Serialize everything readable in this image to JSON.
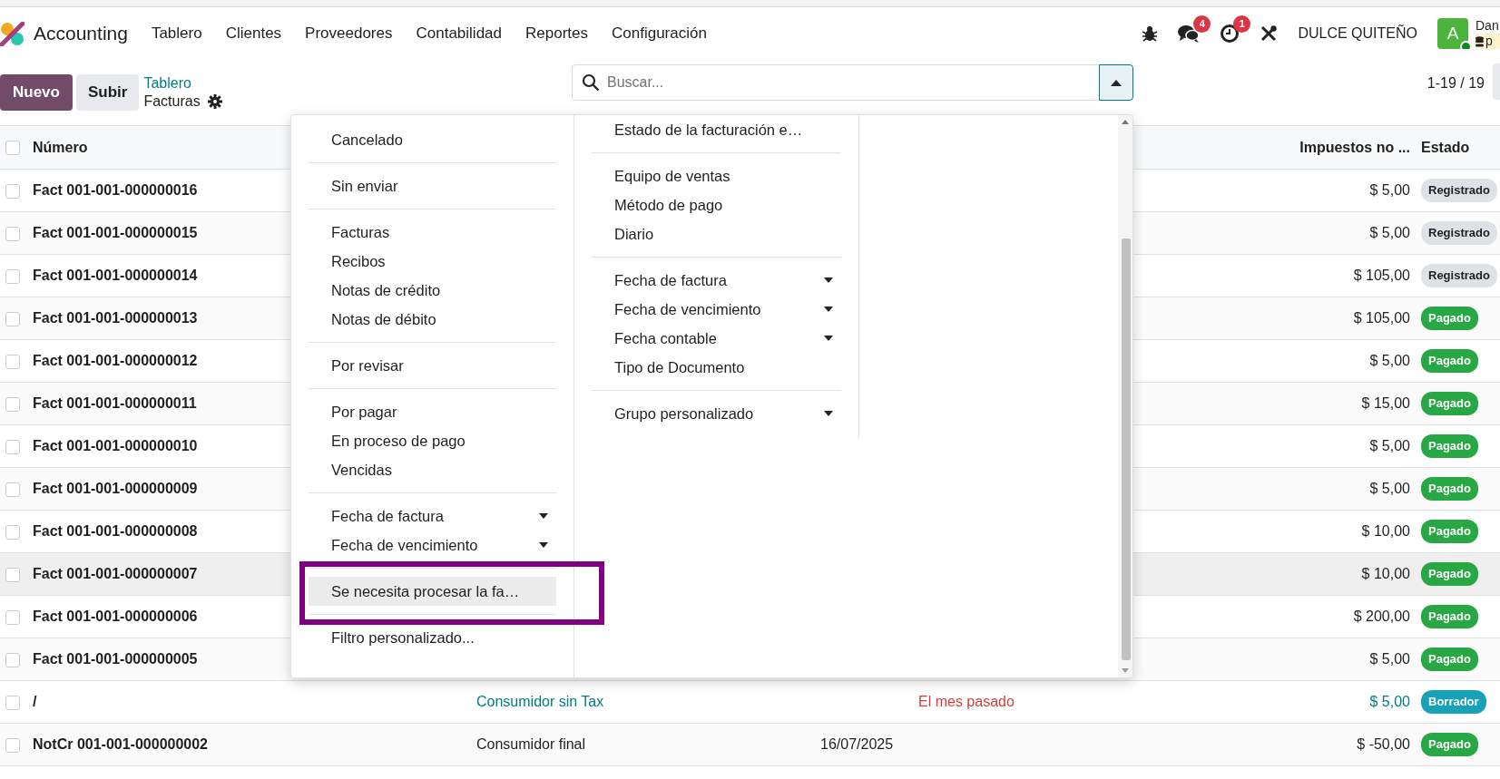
{
  "app": {
    "name": "Accounting"
  },
  "menu": [
    "Tablero",
    "Clientes",
    "Proveedores",
    "Contabilidad",
    "Reportes",
    "Configuración"
  ],
  "systray": {
    "chat_count": "4",
    "activity_count": "1",
    "company": "DULCE QUITEÑO",
    "avatar_letter": "A",
    "online": true,
    "user_name": "Dan",
    "database": "p"
  },
  "control_panel": {
    "new_button": "Nuevo",
    "upload_button": "Subir",
    "breadcrumb": "Tablero",
    "title": "Facturas",
    "search_placeholder": "Buscar...",
    "pager": "1-19 / 19"
  },
  "filter_menu": {
    "filters": [
      [
        {
          "label": "Cancelado",
          "expandable": false,
          "highlighted": false
        }
      ],
      [
        {
          "label": "Sin enviar",
          "expandable": false,
          "highlighted": false
        }
      ],
      [
        {
          "label": "Facturas",
          "expandable": false,
          "highlighted": false
        },
        {
          "label": "Recibos",
          "expandable": false,
          "highlighted": false
        },
        {
          "label": "Notas de crédito",
          "expandable": false,
          "highlighted": false
        },
        {
          "label": "Notas de débito",
          "expandable": false,
          "highlighted": false
        }
      ],
      [
        {
          "label": "Por revisar",
          "expandable": false,
          "highlighted": false
        }
      ],
      [
        {
          "label": "Por pagar",
          "expandable": false,
          "highlighted": false
        },
        {
          "label": "En proceso de pago",
          "expandable": false,
          "highlighted": false
        },
        {
          "label": "Vencidas",
          "expandable": false,
          "highlighted": false
        }
      ],
      [
        {
          "label": "Fecha de factura",
          "expandable": true,
          "highlighted": false
        },
        {
          "label": "Fecha de vencimiento",
          "expandable": true,
          "highlighted": false
        }
      ],
      [
        {
          "label": "Se necesita procesar la fa…",
          "expandable": false,
          "highlighted": true
        }
      ],
      [
        {
          "label": "Filtro personalizado...",
          "expandable": false,
          "highlighted": false
        }
      ]
    ],
    "group_by": [
      [
        {
          "label": "Estado de la facturación e…",
          "expandable": false,
          "highlighted": false
        }
      ],
      [
        {
          "label": "Equipo de ventas",
          "expandable": false,
          "highlighted": false
        },
        {
          "label": "Método de pago",
          "expandable": false,
          "highlighted": false
        },
        {
          "label": "Diario",
          "expandable": false,
          "highlighted": false
        }
      ],
      [
        {
          "label": "Fecha de factura",
          "expandable": true,
          "highlighted": false
        },
        {
          "label": "Fecha de vencimiento",
          "expandable": true,
          "highlighted": false
        },
        {
          "label": "Fecha contable",
          "expandable": true,
          "highlighted": false
        },
        {
          "label": "Tipo de Documento",
          "expandable": false,
          "highlighted": false
        }
      ],
      [
        {
          "label": "Grupo personalizado",
          "expandable": true,
          "highlighted": false
        }
      ]
    ]
  },
  "table": {
    "select_all_checked": false,
    "columns": {
      "number": "Número",
      "amount": "Impuestos no ...",
      "status": "Estado"
    },
    "rows": [
      {
        "number": "Fact 001-001-000000016",
        "amount": "$ 5,00",
        "status": "Registrado",
        "kind": "posted",
        "checked": false,
        "highlighted": false
      },
      {
        "number": "Fact 001-001-000000015",
        "amount": "$ 5,00",
        "status": "Registrado",
        "kind": "posted",
        "checked": false,
        "highlighted": false
      },
      {
        "number": "Fact 001-001-000000014",
        "amount": "$ 105,00",
        "status": "Registrado",
        "kind": "posted",
        "checked": false,
        "highlighted": false
      },
      {
        "number": "Fact 001-001-000000013",
        "amount": "$ 105,00",
        "status": "Pagado",
        "kind": "paid",
        "checked": false,
        "highlighted": false
      },
      {
        "number": "Fact 001-001-000000012",
        "amount": "$ 5,00",
        "status": "Pagado",
        "kind": "paid",
        "checked": false,
        "highlighted": false
      },
      {
        "number": "Fact 001-001-000000011",
        "amount": "$ 15,00",
        "status": "Pagado",
        "kind": "paid",
        "checked": false,
        "highlighted": false
      },
      {
        "number": "Fact 001-001-000000010",
        "amount": "$ 5,00",
        "status": "Pagado",
        "kind": "paid",
        "checked": false,
        "highlighted": false
      },
      {
        "number": "Fact 001-001-000000009",
        "amount": "$ 5,00",
        "status": "Pagado",
        "kind": "paid",
        "checked": false,
        "highlighted": false
      },
      {
        "number": "Fact 001-001-000000008",
        "amount": "$ 10,00",
        "status": "Pagado",
        "kind": "paid",
        "checked": false,
        "highlighted": false
      },
      {
        "number": "Fact 001-001-000000007",
        "amount": "$ 10,00",
        "status": "Pagado",
        "kind": "paid",
        "checked": false,
        "highlighted": true
      },
      {
        "number": "Fact 001-001-000000006",
        "amount": "$ 200,00",
        "status": "Pagado",
        "kind": "paid",
        "checked": false,
        "highlighted": false
      },
      {
        "number": "Fact 001-001-000000005",
        "amount": "$ 5,00",
        "status": "Pagado",
        "kind": "paid",
        "checked": false,
        "highlighted": false
      },
      {
        "number": "/",
        "customer": "Consumidor sin Tax",
        "due": "El mes pasado",
        "amount": "$ 5,00",
        "status": "Borrador",
        "kind": "draft",
        "checked": false,
        "highlighted": false
      },
      {
        "number": "NotCr 001-001-000000002",
        "customer": "Consumidor final",
        "date": "16/07/2025",
        "amount": "$ -50,00",
        "status": "Pagado",
        "kind": "paid",
        "checked": false,
        "highlighted": false
      }
    ]
  }
}
